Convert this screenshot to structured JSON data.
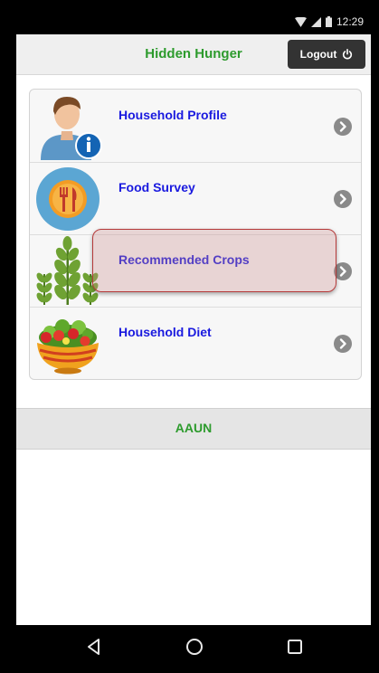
{
  "status_bar": {
    "time": "12:29"
  },
  "header": {
    "title": "Hidden Hunger",
    "logout_label": "Logout"
  },
  "menu": {
    "items": [
      {
        "label": "Household Profile",
        "icon": "user-info-icon"
      },
      {
        "label": "Food Survey",
        "icon": "fork-knife-icon"
      },
      {
        "label": "Recommended Crops",
        "icon": "crop-plant-icon"
      },
      {
        "label": "Household Diet",
        "icon": "salad-bowl-icon"
      }
    ]
  },
  "footer": {
    "text": "AAUN"
  },
  "colors": {
    "title_green": "#2d9b2d",
    "link_blue": "#1a1adf",
    "logout_bg": "#333333",
    "highlight_border": "#b53a3a"
  }
}
